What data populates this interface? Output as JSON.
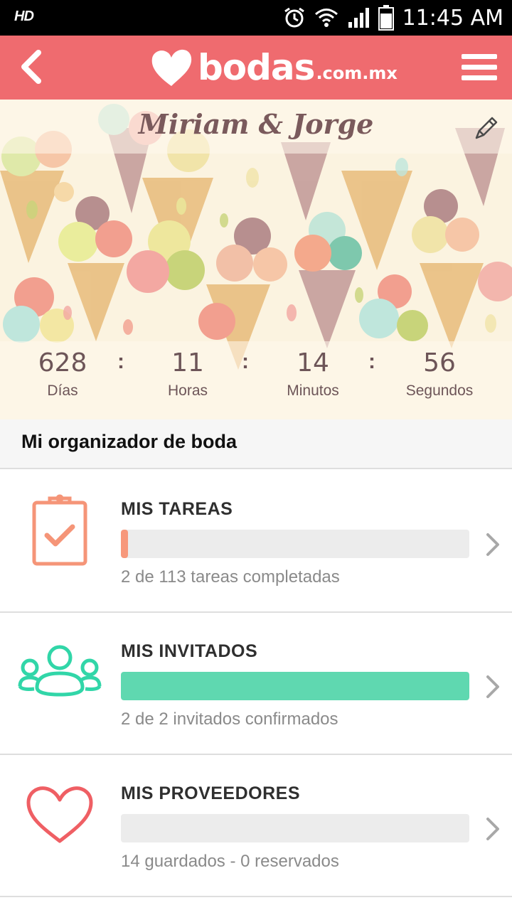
{
  "status_bar": {
    "left_label": "HD",
    "time": "11:45 AM",
    "icons": [
      "alarm-icon",
      "wifi-icon",
      "signal-icon",
      "battery-icon"
    ]
  },
  "app_bar": {
    "logo_text": "bodas",
    "logo_domain": ".com.mx",
    "back_icon": "chevron-left-icon",
    "menu_icon": "hamburger-menu-icon",
    "color": "#ef6b6f"
  },
  "hero": {
    "couple_names": "Miriam & Jorge",
    "edit_icon": "pencil-icon",
    "countdown": [
      {
        "value": "628",
        "label": "Días"
      },
      {
        "value": "11",
        "label": "Horas"
      },
      {
        "value": "14",
        "label": "Minutos"
      },
      {
        "value": "56",
        "label": "Segundos"
      }
    ],
    "separator": ":"
  },
  "section": {
    "title": "Mi organizador de boda"
  },
  "cards": [
    {
      "title": "MIS TAREAS",
      "subtitle": "2 de 113 tareas completadas",
      "progress": 0.018,
      "bar_color": "#f7987b",
      "icon": "clipboard-check-icon"
    },
    {
      "title": "MIS INVITADOS",
      "subtitle": "2 de 2 invitados confirmados",
      "progress": 1.0,
      "bar_color": "#5fd8b0",
      "icon": "group-people-icon"
    },
    {
      "title": "MIS PROVEEDORES",
      "subtitle": "14 guardados - 0 reservados",
      "progress": 0,
      "bar_color": "#ef6b6f",
      "icon": "heart-outline-icon"
    }
  ]
}
